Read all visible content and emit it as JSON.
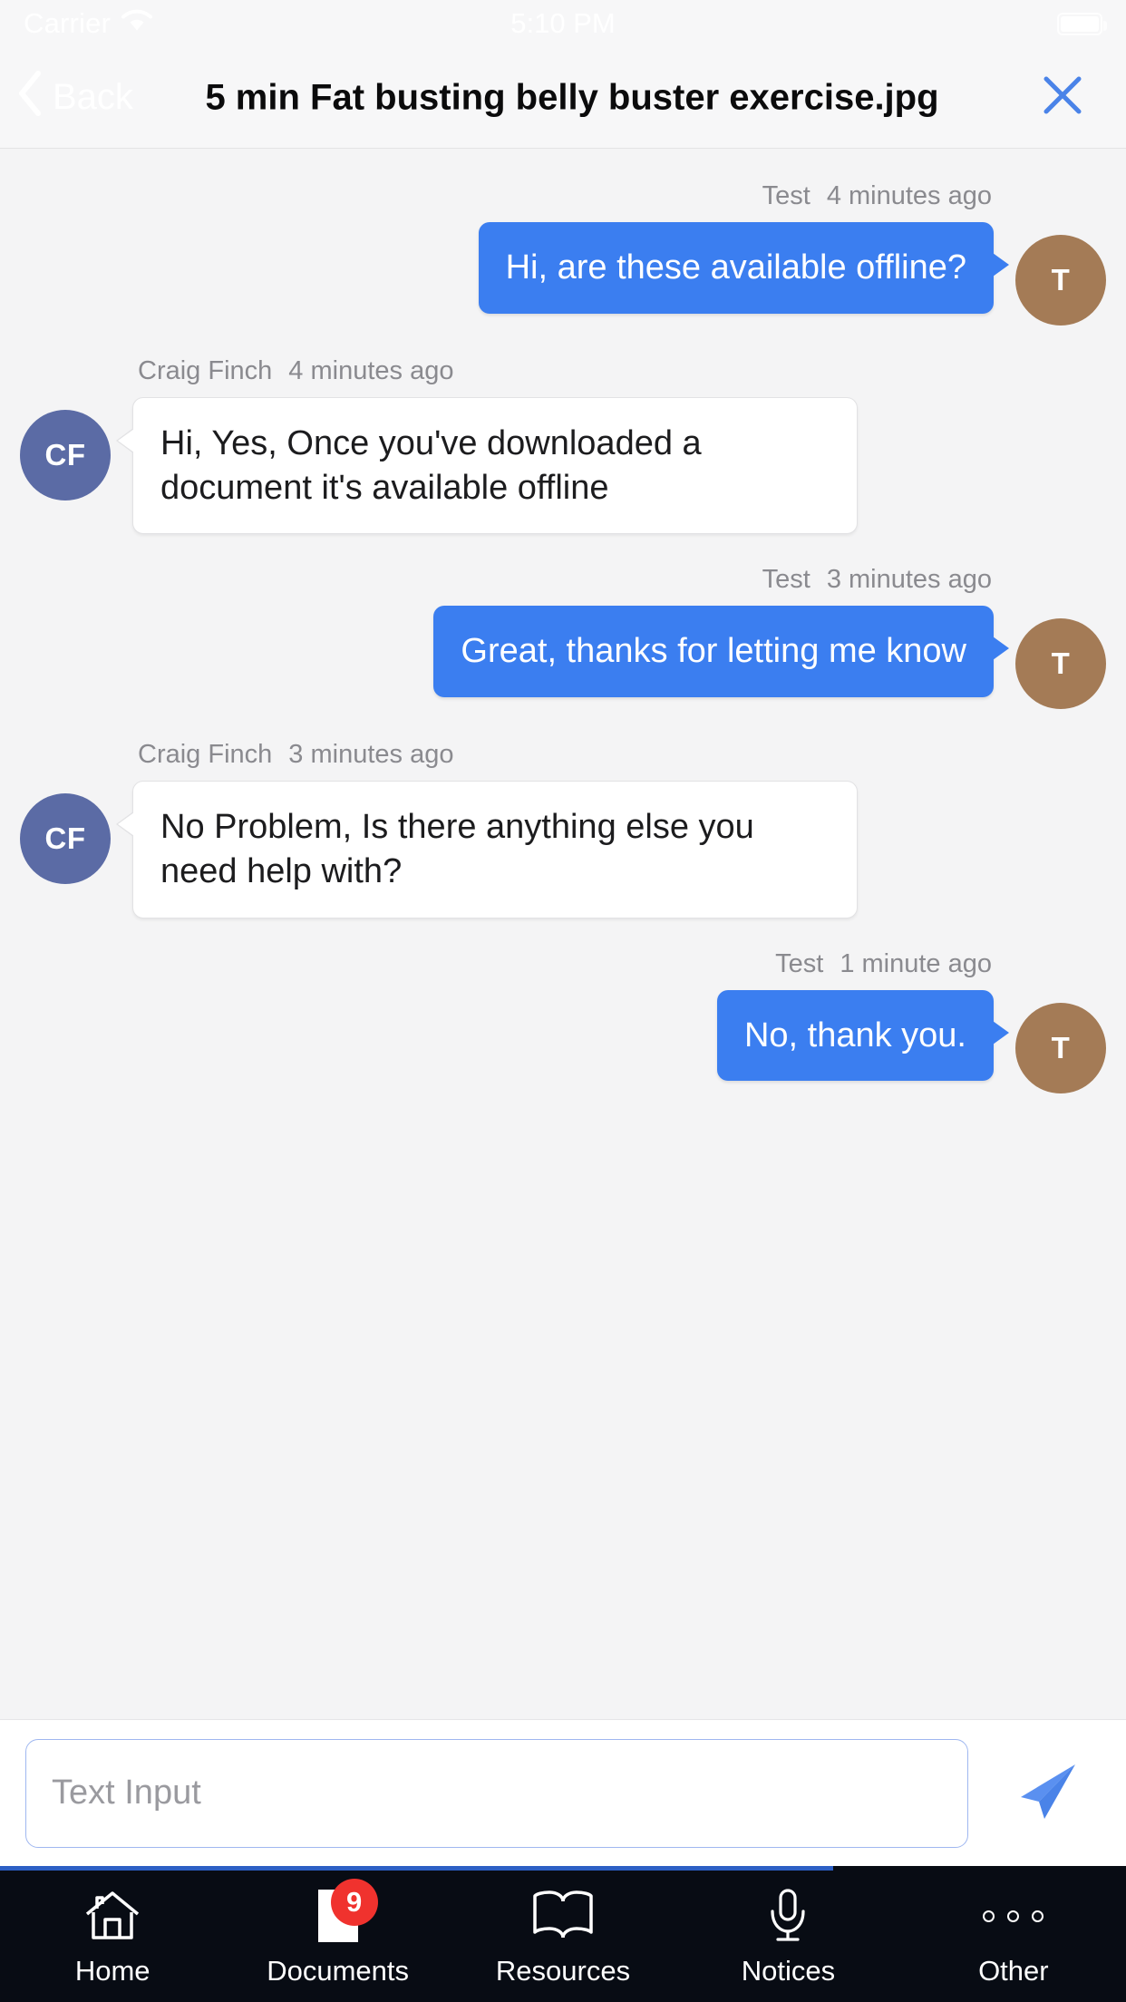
{
  "statusbar": {
    "carrier": "Carrier",
    "time": "5:10 PM",
    "wifi_icon": "wifi-icon",
    "battery_icon": "battery-full-icon"
  },
  "navbar": {
    "back_label": "Back",
    "back_icon": "chevron-left-icon",
    "title": "5 min Fat busting belly buster exercise.jpg",
    "close_icon": "close-icon",
    "close_color": "#4a83e8",
    "title_color": "#0b0b0c"
  },
  "thread": {
    "messages": [
      {
        "direction": "out",
        "sender": "Test",
        "time": "4 minutes ago",
        "text": "Hi, are these available offline?",
        "avatar_initials": "T",
        "avatar_color": "#a47b56",
        "bubble_color": "#3b7ef0"
      },
      {
        "direction": "in",
        "sender": "Craig Finch",
        "time": "4 minutes ago",
        "text": "Hi, Yes, Once you've downloaded a document it's available offline",
        "avatar_initials": "CF",
        "avatar_color": "#5b6ba5",
        "bubble_color": "#ffffff"
      },
      {
        "direction": "out",
        "sender": "Test",
        "time": "3 minutes ago",
        "text": "Great, thanks for letting me know",
        "avatar_initials": "T",
        "avatar_color": "#a47b56",
        "bubble_color": "#3b7ef0"
      },
      {
        "direction": "in",
        "sender": "Craig Finch",
        "time": "3 minutes ago",
        "text": "No Problem, Is there anything else you need help with?",
        "avatar_initials": "CF",
        "avatar_color": "#5b6ba5",
        "bubble_color": "#ffffff"
      },
      {
        "direction": "out",
        "sender": "Test",
        "time": "1 minute ago",
        "text": "No, thank you.",
        "avatar_initials": "T",
        "avatar_color": "#a47b56",
        "bubble_color": "#3b7ef0"
      }
    ]
  },
  "composer": {
    "placeholder": "Text Input",
    "value": "",
    "send_icon": "send-paper-plane-icon",
    "send_color": "#4a83e8"
  },
  "tabbar": {
    "background": "#080c14",
    "items": [
      {
        "label": "Home",
        "icon": "home-icon",
        "badge": ""
      },
      {
        "label": "Documents",
        "icon": "document-icon",
        "badge": "9"
      },
      {
        "label": "Resources",
        "icon": "book-icon",
        "badge": ""
      },
      {
        "label": "Notices",
        "icon": "microphone-icon",
        "badge": ""
      },
      {
        "label": "Other",
        "icon": "ellipsis-icon",
        "badge": ""
      }
    ],
    "badge_color": "#f0322e"
  }
}
